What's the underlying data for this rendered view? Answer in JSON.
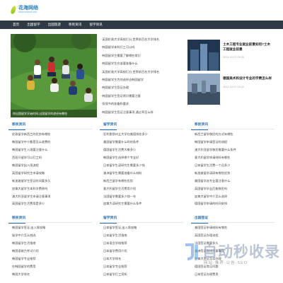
{
  "brand": {
    "title": "花海网络",
    "subtitle": "www.huahai.com"
  },
  "nav": [
    "首页",
    "出国留学",
    "出国旅游",
    "移民资讯",
    "留学资讯"
  ],
  "hero": {
    "caption": "你出国留学开始时间,出国留学的途径有哪些"
  },
  "headlines": [
    "·英国伦敦大学高校打分,世界前百名大学排名",
    "·韩国留学本科打工可以吗",
    "·韩国留学生需要了解哪些常识",
    "·韩国留学生应该要准备什么",
    "·英国伦敦大学高校打分,世界前百名大学排名",
    "·韩国留学生为何选择去韩国留学",
    "·韩国留学生签证办理",
    "·韩国留学生签证常识需要注意",
    "·担保书的准备和要求",
    "·韩国留学生签证注意事项,通过率怎么样"
  ],
  "side_cards": [
    {
      "title": "土木工程专业就业前景如何?土木工程就业前景",
      "date": "2024-10-07 09:30"
    },
    {
      "title": "德国美术和设计专业的学费怎么样",
      "date": "2024-10-07 09:30"
    }
  ],
  "sections_row1": [
    {
      "title": "移民资讯",
      "items": [
        "佐敦留学新西兰的优势有哪些",
        "韩国留学中介都是怎么收费的",
        "韩国留学生入境要注意什么",
        "西班牙留学可以打工吗",
        "韩国留学出入境流程",
        "英国留学研究生申请攻略",
        "新加坡留学生签证时间要多久",
        "加拿大留学生本科学费贵吗",
        "澳大利亚留学生申请注意事项",
        "英国留学生活费用是多少"
      ]
    },
    {
      "title": "留学资讯",
      "items": [
        "亚利桑那州立大学在美国排名多少",
        "美国留学需要什么样的条件",
        "德国留学生活费大概多少",
        "韩国留学生选择哪个专业好",
        "日本留学生读研究生需要多少钱",
        "澳洲留学生需要准备什么材料",
        "新西兰留学有哪些优势",
        "意大利留学生活费用介绍",
        "法国留学需要多少钱一年",
        "加拿大读研究生需要什么条件"
      ]
    },
    {
      "title": "移民资讯",
      "items": [
        "新西兰留学移民的方式有哪些",
        "韩国留学申请签证的流程",
        "澳大利亚留学移民需要什么条件",
        "意大利留学申请材料有哪些",
        "日本留学生活费一个月多少",
        "新加坡留学读研有哪些优势",
        "美国留学选专业要注意什么",
        "英国留学毕业后能移民吗",
        "加拿大留学中介怎么选择",
        "德国留学申请的时间安排"
      ]
    }
  ],
  "sections_row2": [
    {
      "title": "移民资讯",
      "items": [
        "韩国留学签证,出入境攻略",
        "留学中介怎么挑选",
        "韩国留学生活指南",
        "韩国语能力考试介绍",
        "韩国留学专业推荐",
        "在韩国留学的费用",
        "韩国大学排名"
      ]
    },
    {
      "title": "留学资讯",
      "items": [
        "日本留学签证,出入境攻略",
        "日本留学生活指南",
        "日本语言学校推荐",
        "日本留学费用介绍",
        "日本大学排名",
        "日本留学专业推荐",
        "日本留学打工须知"
      ]
    },
    {
      "title": "出国签证",
      "items": [
        "美国签证申请材料有哪些",
        "英国签证办理流程",
        "法国签证需要多久",
        "澳洲签证面试注意事项",
        "加拿大签证怎么办理",
        "德国签证常见问题",
        "日本签证办理费用"
      ]
    }
  ],
  "watermark": {
    "title": "自动秒收录",
    "subtitle": "网站·推荐·公告·SEO"
  }
}
